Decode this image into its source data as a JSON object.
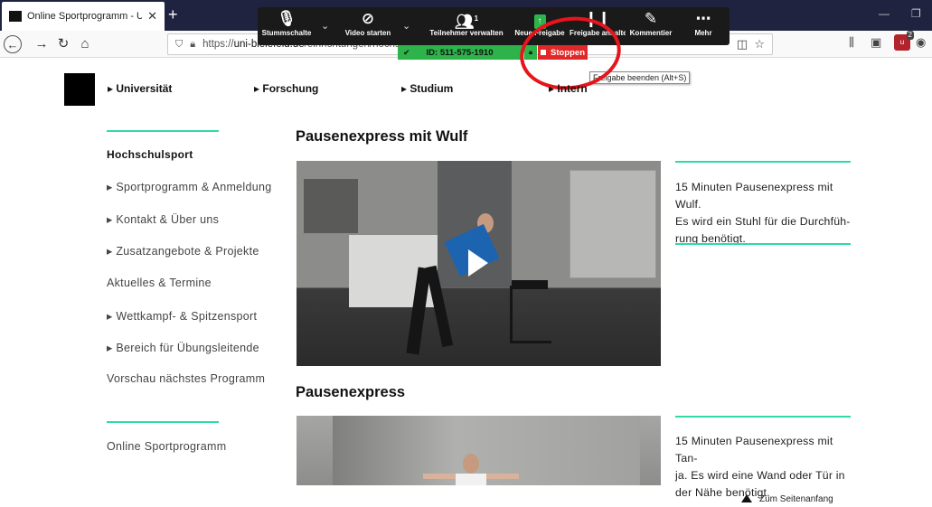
{
  "browser": {
    "tab_title": "Online Sportprogramm - Unive",
    "new_tab": "+",
    "tab_close": "✕",
    "url_prefix": "https://",
    "url_domain": "uni-bielefeld.de",
    "url_path": "/einrichtungen/hochs"
  },
  "zoom": {
    "items": [
      {
        "label": "Stummschalte",
        "icon": "microphone-icon"
      },
      {
        "label": "Video starten",
        "icon": "video-off-icon"
      },
      {
        "label": "Teilnehmer verwalten",
        "icon": "participants-icon",
        "count": "1"
      },
      {
        "label": "Neue Freigabe",
        "icon": "share-icon"
      },
      {
        "label": "Freigabe anhalten",
        "icon": "pause-icon"
      },
      {
        "label": "Kommentier",
        "icon": "annotate-icon"
      },
      {
        "label": "Mehr",
        "icon": "more-icon"
      }
    ],
    "meeting_id": "ID: 511-575-1910",
    "stop_label": "Stoppen",
    "tooltip": "Freigabe beenden (Alt+S)"
  },
  "nav": {
    "items": [
      "▸ Universität",
      "▸ Forschung",
      "▸ Studium",
      "▸ Intern"
    ]
  },
  "sidebar": {
    "heading": "Hochschulsport",
    "items": [
      "▸ Sportprogramm & Anmeldung",
      "▸ Kontakt & Über uns",
      "▸ Zusatzangebote & Projekte",
      "Aktuelles & Termine",
      "▸ Wettkampf- & Spitzensport",
      "▸ Bereich für Übungsleitende",
      "Vorschau nächstes Programm"
    ],
    "bottom_item": "Online Sportprogramm"
  },
  "main": {
    "videos": [
      {
        "title": "Pausenexpress mit Wulf",
        "desc_lines": [
          "15 Minuten Pausenexpress mit Wulf.",
          "Es wird ein Stuhl für die Durchfüh-",
          "rung benötigt."
        ]
      },
      {
        "title": "Pausenexpress",
        "desc_lines": [
          "15 Minuten Pausenexpress mit Tan-",
          "ja. Es wird eine Wand oder Tür in",
          "der Nähe benötigt."
        ]
      }
    ],
    "to_top": "Zum Seitenanfang"
  },
  "colors": {
    "accent_line": "#30d9a6",
    "stop_red": "#e02828",
    "zoom_green": "#2db34a",
    "annotation_circle": "#e8141c"
  }
}
